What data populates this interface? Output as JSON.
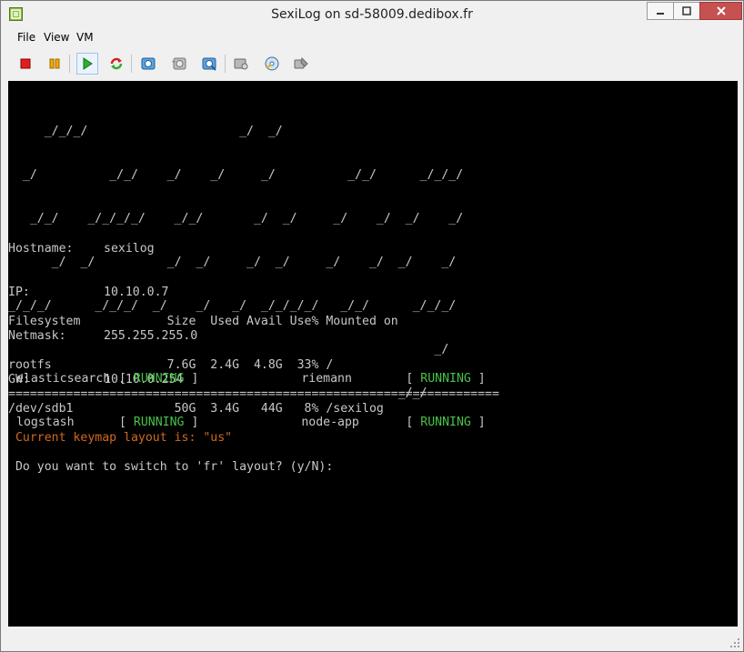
{
  "window": {
    "title": "SexiLog on sd-58009.dedibox.fr"
  },
  "menu": [
    "File",
    "View",
    "VM"
  ],
  "toolbar": {
    "buttons": [
      {
        "name": "power-off",
        "icon": "stop-square-icon"
      },
      {
        "name": "suspend",
        "icon": "pause-icon"
      },
      {
        "name": "power-on",
        "icon": "play-icon"
      },
      {
        "name": "reset",
        "icon": "reset-icon"
      },
      {
        "name": "snapshot",
        "icon": "snapshot-icon"
      },
      {
        "name": "revert-snapshot",
        "icon": "revert-snapshot-icon"
      },
      {
        "name": "snapshot-manager",
        "icon": "snapshot-manager-icon"
      },
      {
        "name": "cd-drive",
        "icon": "cd-drive-icon"
      },
      {
        "name": "floppy-drive",
        "icon": "floppy-drive-icon"
      },
      {
        "name": "network",
        "icon": "network-icon"
      }
    ]
  },
  "console": {
    "banner": [
      "     _/_/_/                     _/  _/",
      "  _/          _/_/    _/    _/     _/          _/_/      _/_/_/",
      "   _/_/    _/_/_/_/    _/_/       _/  _/     _/    _/  _/    _/",
      "      _/  _/          _/  _/     _/  _/     _/    _/  _/    _/",
      "_/_/_/      _/_/_/  _/    _/   _/  _/_/_/_/   _/_/      _/_/_/",
      "                                                           _/",
      "                                                      _/_/"
    ],
    "network": [
      {
        "label": "Hostname:",
        "value": "sexilog"
      },
      {
        "label": "IP:",
        "value": "10.10.0.7"
      },
      {
        "label": "Netmask:",
        "value": "255.255.255.0"
      },
      {
        "label": "GW:",
        "value": "10.10.0.254"
      }
    ],
    "filesystem": {
      "header": "Filesystem            Size  Used Avail Use% Mounted on",
      "rows": [
        "rootfs                7.6G  2.4G  4.8G  33% /",
        "/dev/sdb1              50G  3.4G   44G   8% /sexilog"
      ]
    },
    "services": [
      {
        "name": "elasticsearch",
        "status": "RUNNING"
      },
      {
        "name": "riemann",
        "status": "RUNNING"
      },
      {
        "name": "logstash",
        "status": "RUNNING"
      },
      {
        "name": "node-app",
        "status": "RUNNING"
      }
    ],
    "separator": "====================================================================",
    "keymap_line": " Current keymap layout is: \"us\"",
    "prompt_line": " Do you want to switch to 'fr' layout? (y/N):"
  },
  "colors": {
    "terminal_bg": "#000000",
    "terminal_fg": "#c8c8c8",
    "running": "#47c247",
    "notice": "#d2691e",
    "close_button": "#c75050"
  }
}
